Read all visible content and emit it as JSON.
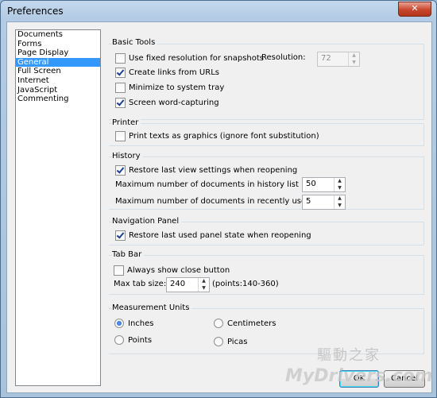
{
  "window": {
    "title": "Preferences",
    "close_glyph": "✕"
  },
  "categories": [
    "Documents",
    "Forms",
    "Page Display",
    "General",
    "Full Screen",
    "Internet",
    "JavaScript",
    "Commenting"
  ],
  "selected_category": "General",
  "basic_tools": {
    "label": "Basic Tools",
    "fixed_resolution": {
      "label": "Use fixed resolution for snapshots",
      "checked": false
    },
    "resolution_label": "Resolution:",
    "resolution_value": "72",
    "create_links": {
      "label": "Create links from URLs",
      "checked": true
    },
    "minimize_tray": {
      "label": "Minimize to system tray",
      "checked": false
    },
    "word_capturing": {
      "label": "Screen word-capturing",
      "checked": true
    }
  },
  "printer": {
    "label": "Printer",
    "texts_as_graphics": {
      "label": "Print texts as graphics (ignore font substitution)",
      "checked": false
    }
  },
  "history": {
    "label": "History",
    "restore_view": {
      "label": "Restore last view settings when reopening",
      "checked": true
    },
    "max_history_label": "Maximum number of documents in history list :",
    "max_history_value": "50",
    "max_recent_label": "Maximum number of documents in recently used list:",
    "max_recent_value": "5"
  },
  "navigation_panel": {
    "label": "Navigation Panel",
    "restore_panel": {
      "label": "Restore last used panel state when reopening",
      "checked": true
    }
  },
  "tab_bar": {
    "label": "Tab Bar",
    "always_close": {
      "label": "Always show close button",
      "checked": false
    },
    "max_tab_label": "Max tab size:",
    "max_tab_value": "240",
    "max_tab_hint": "(points:140-360)"
  },
  "measurement_units": {
    "label": "Measurement Units",
    "inches": "Inches",
    "centimeters": "Centimeters",
    "points": "Points",
    "picas": "Picas",
    "selected": "Inches"
  },
  "buttons": {
    "ok": "OK",
    "cancel": "Cancel"
  },
  "watermark": {
    "line1": "驅動之家",
    "line2": "MyDrivers.com"
  }
}
